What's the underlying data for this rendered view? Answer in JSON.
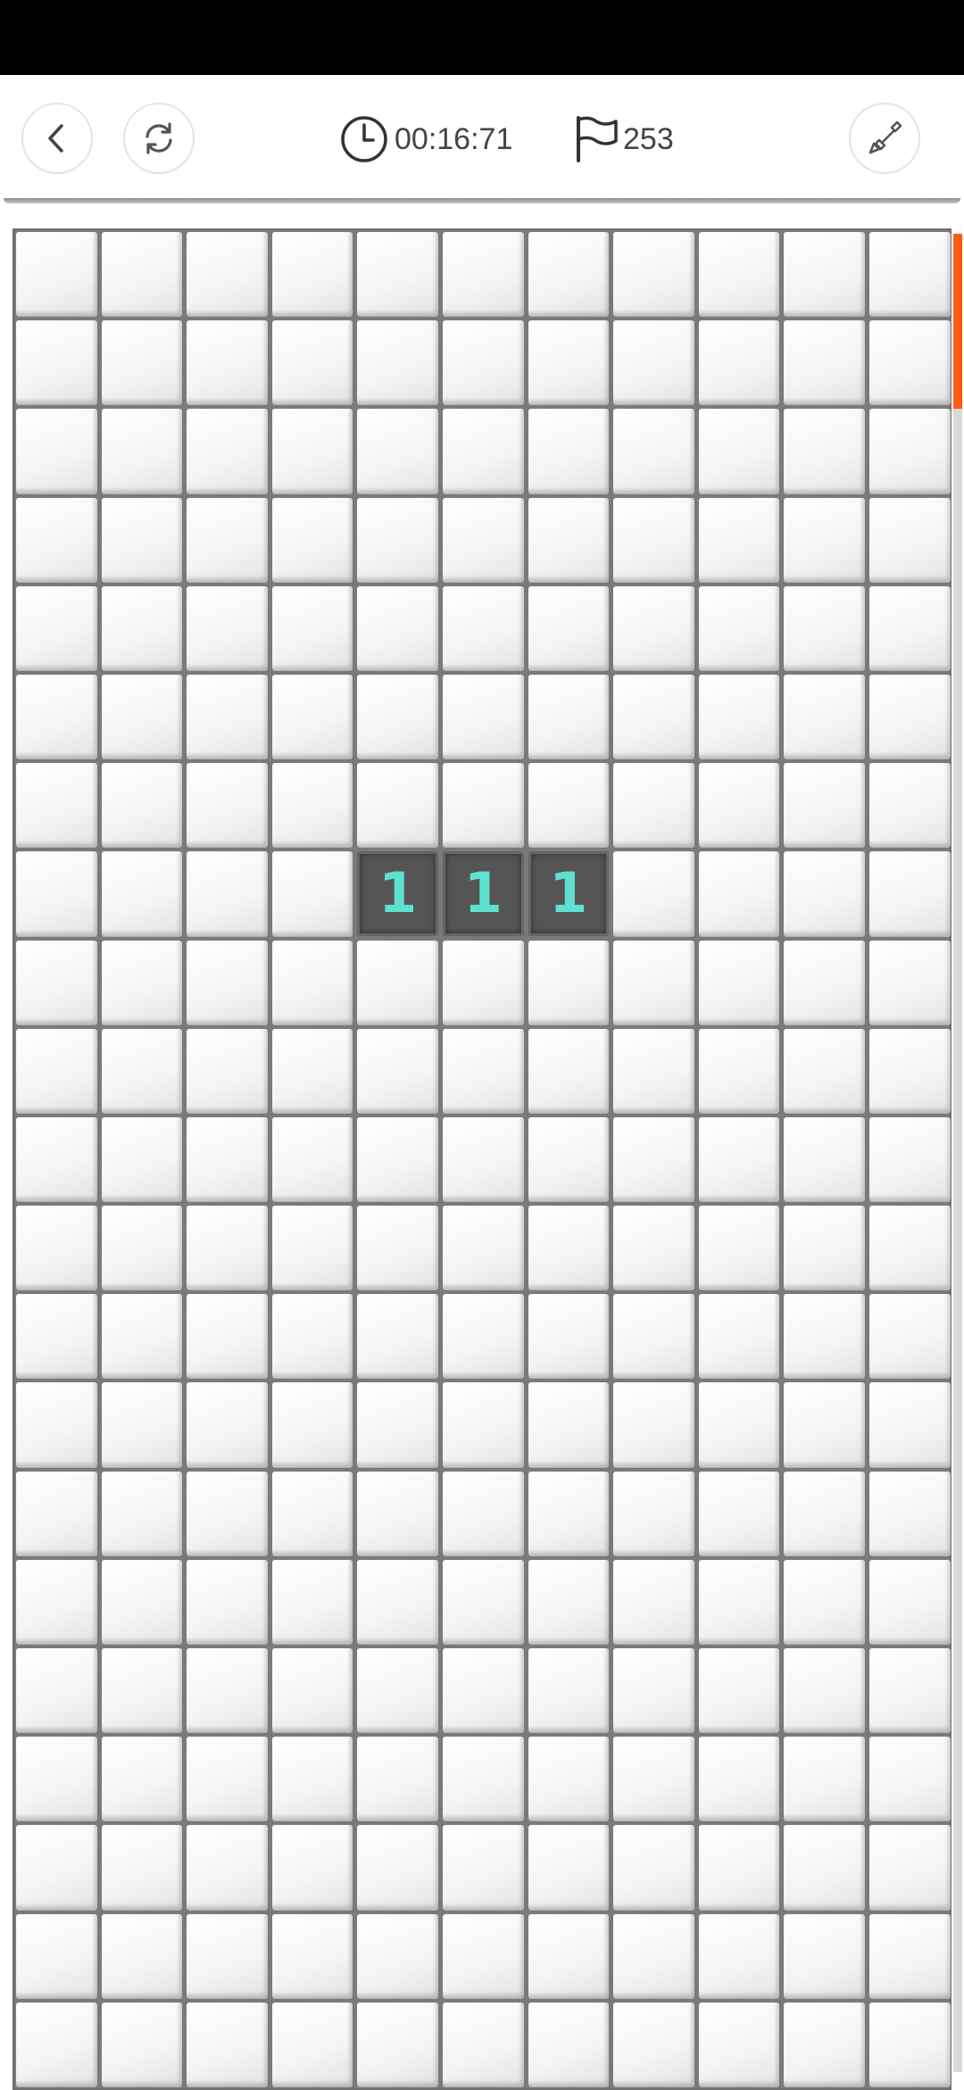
{
  "header": {
    "timer": "00:16:71",
    "flags_remaining": "253"
  },
  "icons": {
    "back": "back-chevron-icon",
    "restart": "restart-icon",
    "clock": "clock-icon",
    "flag": "flag-icon",
    "mode": "shovel-icon"
  },
  "colors": {
    "status_bar": "#000000",
    "number_1": "#5ee2cf",
    "scroll_thumb": "#ff5a14",
    "revealed_cell": "#555555"
  },
  "board": {
    "columns": 11,
    "rows": 21,
    "revealed": [
      {
        "row": 8,
        "col": 5,
        "value": "1"
      },
      {
        "row": 8,
        "col": 6,
        "value": "1"
      },
      {
        "row": 8,
        "col": 7,
        "value": "1"
      }
    ]
  }
}
